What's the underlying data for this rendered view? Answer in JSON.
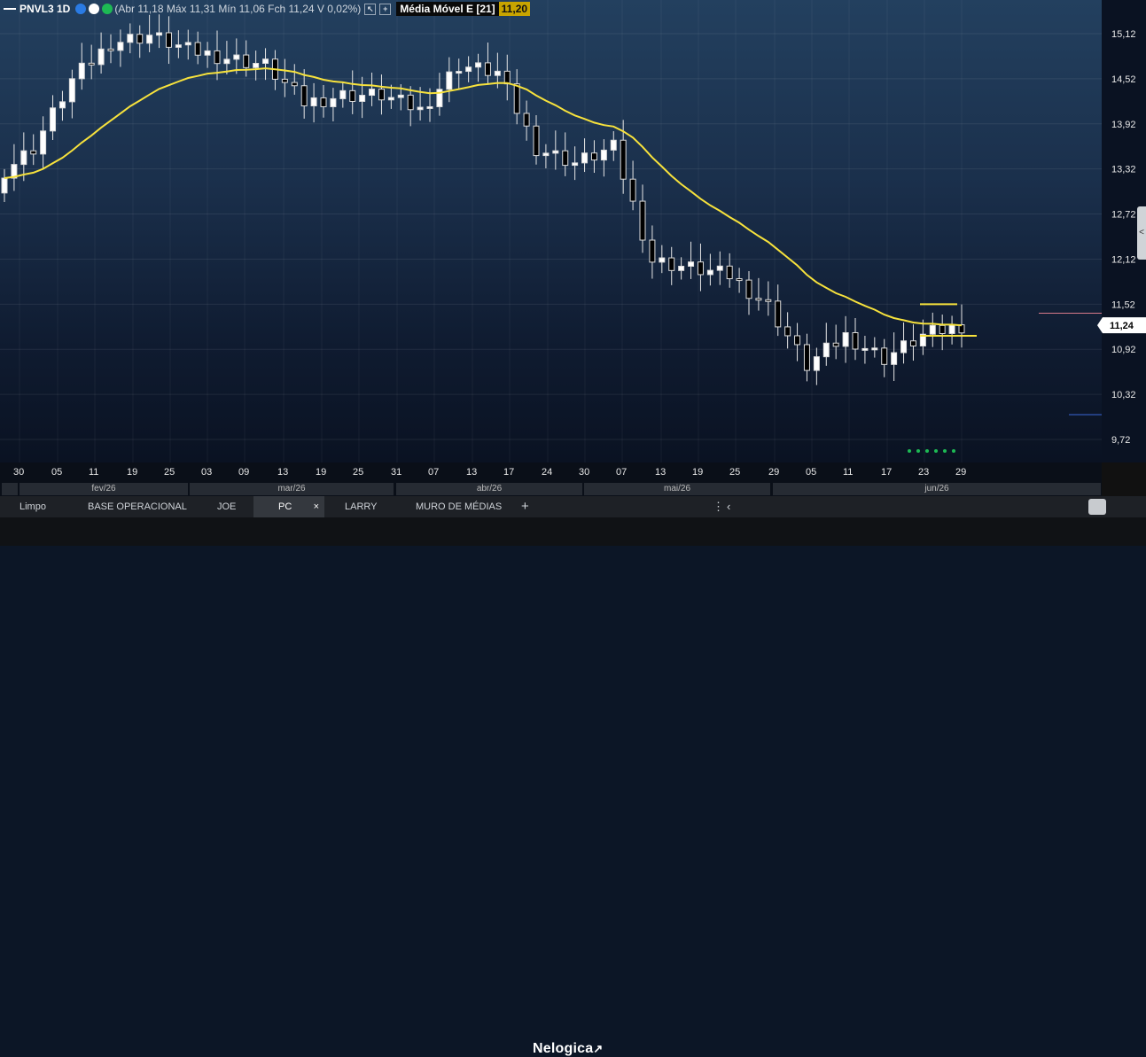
{
  "legend": {
    "symbol": "PNVL3 1D",
    "ohlc": "(Abr 11,18 Máx 11,31 Mín 11,06 Fch 11,24 V 0,02%)",
    "indicator_label": "Média Móvel E [21]",
    "indicator_value": "11,20"
  },
  "colors": {
    "ma_line": "#f7e23c",
    "candle_up": "#ffffff",
    "candle_down": "#000000",
    "wick": "#e6e6e6",
    "current_price_tag": "#ffffff"
  },
  "price_axis": {
    "ticks": [
      "15,12",
      "14,52",
      "13,92",
      "13,32",
      "12,72",
      "12,12",
      "11,52",
      "10,92",
      "10,32",
      "9,72"
    ],
    "current_price": "11,24"
  },
  "date_axis": {
    "labels": [
      "30",
      "05",
      "11",
      "19",
      "25",
      "03",
      "09",
      "13",
      "19",
      "25",
      "31",
      "07",
      "13",
      "17",
      "24",
      "30",
      "07",
      "13",
      "19",
      "25",
      "29",
      "05",
      "11",
      "17",
      "23",
      "29"
    ]
  },
  "months": [
    "fev/26",
    "mar/26",
    "abr/26",
    "mai/26",
    "jun/26"
  ],
  "tabs": [
    {
      "label": "Limpo"
    },
    {
      "label": "BASE OPERACIONAL"
    },
    {
      "label": "JOE"
    },
    {
      "label": "PC",
      "active": true,
      "close": "×"
    },
    {
      "label": "LARRY"
    },
    {
      "label": "MURO DE MÉDIAS"
    }
  ],
  "add_tab": "+",
  "brand": "Nelogica",
  "chart_data": {
    "type": "candlestick",
    "x": [
      "30",
      "05",
      "11",
      "19",
      "25",
      "03",
      "09",
      "13",
      "19",
      "25",
      "31",
      "07",
      "13",
      "17",
      "24",
      "30",
      "07",
      "13",
      "19",
      "25",
      "29",
      "05",
      "11",
      "17",
      "23",
      "29"
    ],
    "close_prices_approx": [
      13.2,
      13.6,
      14.5,
      15.0,
      15.1,
      14.9,
      14.8,
      14.7,
      14.2,
      14.3,
      14.3,
      14.1,
      14.7,
      14.6,
      13.6,
      13.4,
      13.6,
      12.1,
      12.0,
      11.9,
      11.5,
      10.7,
      11.1,
      10.8,
      11.1,
      11.24
    ],
    "ma_label": "Média Móvel E [21]",
    "ma_last": 11.2,
    "ylim": [
      9.6,
      15.5
    ],
    "grid": true
  }
}
